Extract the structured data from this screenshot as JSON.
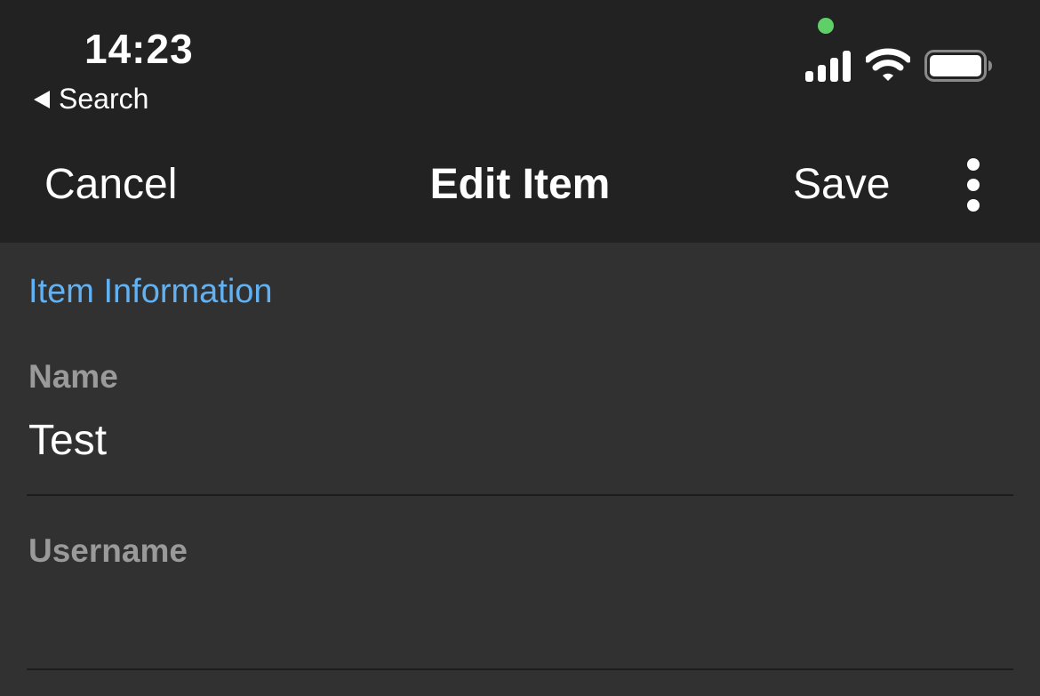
{
  "status_bar": {
    "time": "14:23",
    "back_label": "Search",
    "camera_indicator_color": "#5fd068",
    "icons": [
      "signal-icon",
      "wifi-icon",
      "battery-icon"
    ]
  },
  "nav_bar": {
    "cancel_label": "Cancel",
    "title": "Edit Item",
    "save_label": "Save",
    "more_icon": "more-vertical-icon"
  },
  "section": {
    "header": "Item Information",
    "accent_color": "#62b1f2"
  },
  "fields": {
    "name": {
      "label": "Name",
      "value": "Test"
    },
    "username": {
      "label": "Username",
      "value": ""
    }
  }
}
